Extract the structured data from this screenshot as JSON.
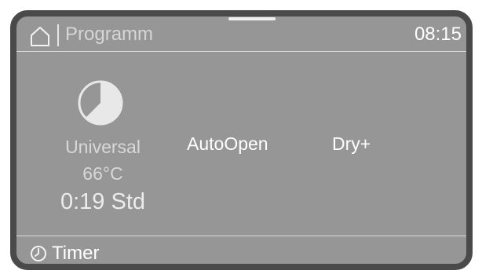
{
  "header": {
    "title": "Programm",
    "time": "08:15",
    "home_icon": "home-icon"
  },
  "program": {
    "icon": "universal-program-icon",
    "name": "Universal",
    "temperature": "66°C",
    "duration": "0:19 Std"
  },
  "options": {
    "autoopen_label": "AutoOpen",
    "dry_label": "Dry+"
  },
  "footer": {
    "timer_icon": "clock-icon",
    "timer_label": "Timer"
  },
  "colors": {
    "display_bg": "#969696",
    "bezel": "#4a4a4a",
    "text_primary": "#ffffff",
    "text_secondary": "#d8d8d8"
  }
}
